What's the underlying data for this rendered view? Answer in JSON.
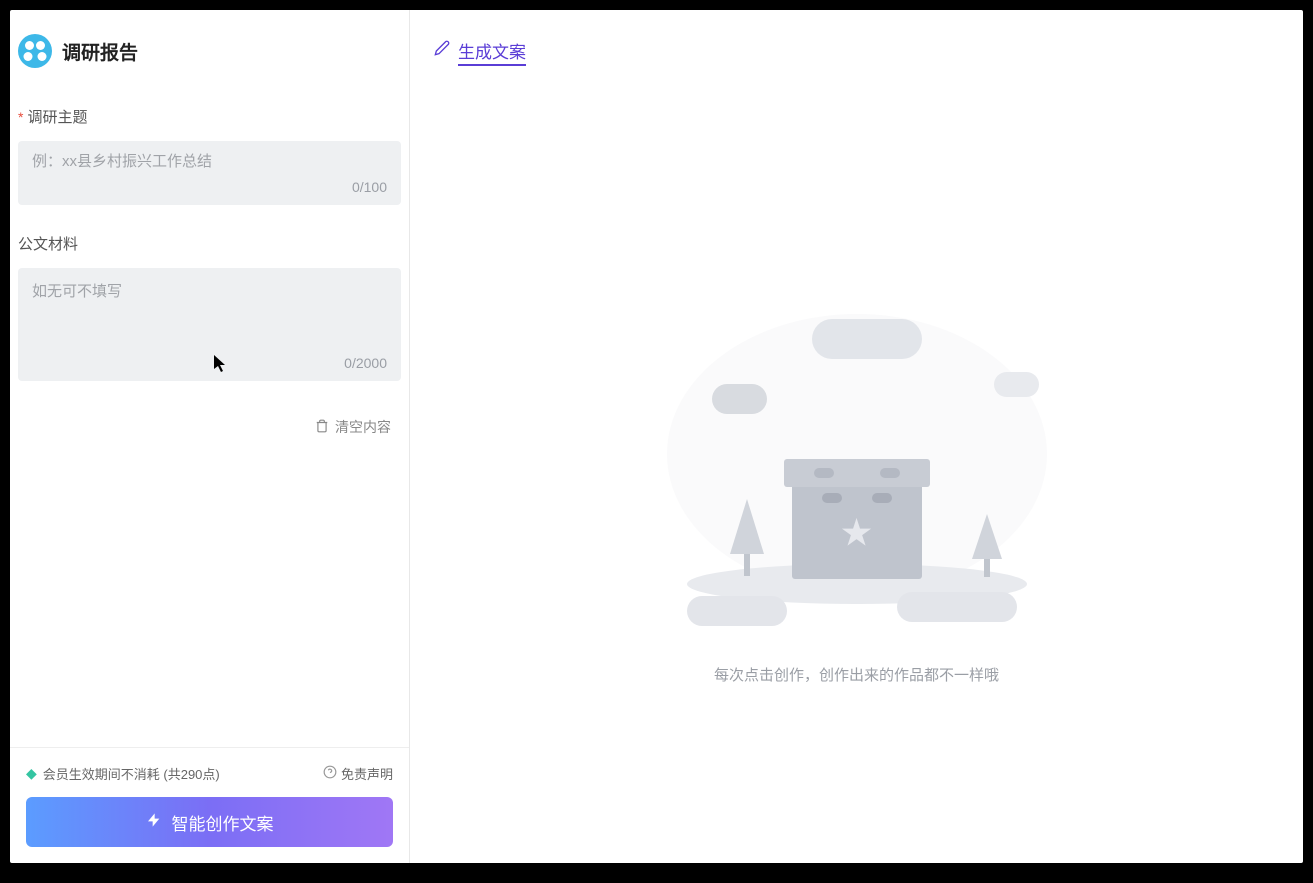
{
  "sidebar": {
    "title": "调研报告",
    "fields": {
      "topic": {
        "label": "调研主题",
        "required": true,
        "placeholder": "例：xx县乡村振兴工作总结",
        "value": "",
        "counter": "0/100"
      },
      "material": {
        "label": "公文材料",
        "required": false,
        "placeholder": "如无可不填写",
        "value": "",
        "counter": "0/2000"
      }
    },
    "clear_label": "清空内容",
    "footer": {
      "membership_text": "会员生效期间不消耗 (共290点)",
      "disclaimer_label": "免责声明",
      "generate_label": "智能创作文案"
    }
  },
  "main": {
    "header_link": "生成文案",
    "empty_text": "每次点击创作，创作出来的作品都不一样哦"
  }
}
